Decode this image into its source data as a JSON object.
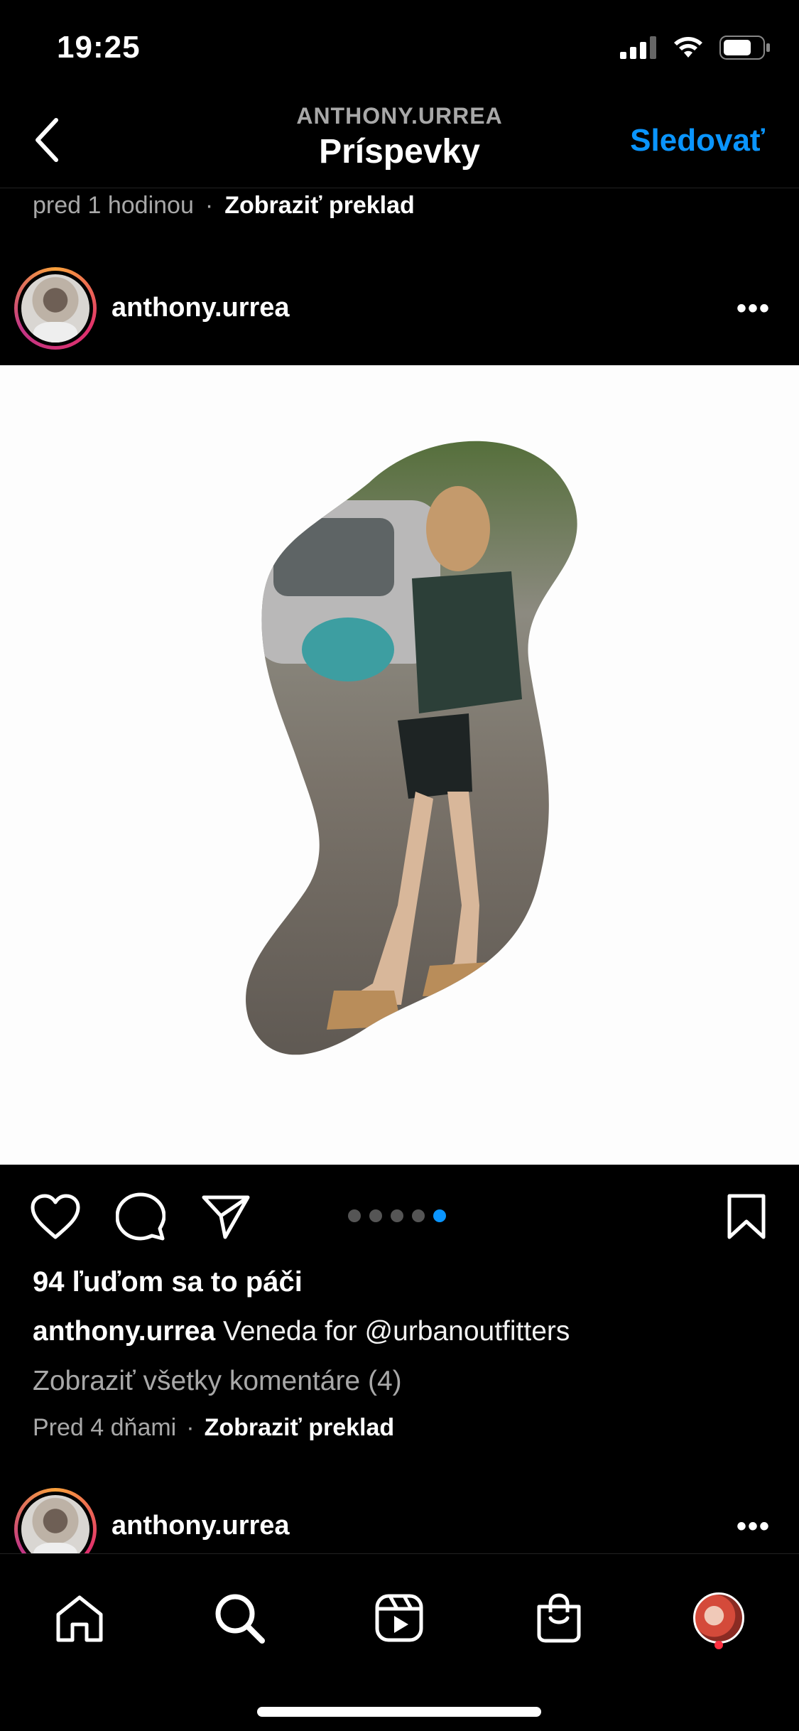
{
  "status_bar": {
    "time": "19:25"
  },
  "header": {
    "subtitle": "ANTHONY.URREA",
    "title": "Príspevky",
    "follow_label": "Sledovať"
  },
  "previous_post": {
    "time_ago": "pred 1 hodinou",
    "separator": "·",
    "translate_label": "Zobraziť preklad"
  },
  "post": {
    "username": "anthony.urrea",
    "more": "•••",
    "likes": "94 ľuďom sa to páči",
    "caption_user": "anthony.urrea",
    "caption_text": "Veneda for @urbanoutfitters",
    "view_comments": "Zobraziť všetky komentáre (4)",
    "time_ago": "Pred 4 dňami",
    "separator": "·",
    "translate_label": "Zobraziť preklad",
    "carousel": {
      "count": 5,
      "active_index": 4
    }
  },
  "next_post": {
    "username": "anthony.urrea",
    "more": "•••"
  },
  "tab_bar": {
    "items": [
      "home-icon",
      "search-icon",
      "reels-icon",
      "shop-icon",
      "profile-avatar"
    ]
  },
  "colors": {
    "accent": "#0a95ff",
    "background": "#000000",
    "muted": "#a8a8a8",
    "notification": "#ff3040"
  }
}
